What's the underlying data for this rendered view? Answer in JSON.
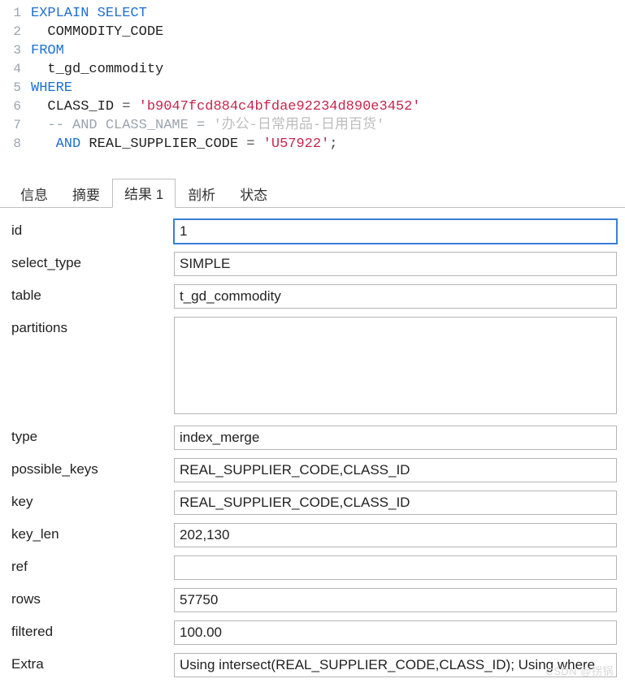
{
  "code": {
    "lines": [
      {
        "n": "1",
        "tokens": [
          {
            "t": "EXPLAIN SELECT",
            "c": "kw"
          }
        ]
      },
      {
        "n": "2",
        "tokens": [
          {
            "t": "  ",
            "c": "plain"
          },
          {
            "t": "COMMODITY_CODE",
            "c": "plain"
          }
        ]
      },
      {
        "n": "3",
        "tokens": [
          {
            "t": "FROM",
            "c": "kw"
          }
        ]
      },
      {
        "n": "4",
        "tokens": [
          {
            "t": "  ",
            "c": "plain"
          },
          {
            "t": "t_gd_commodity",
            "c": "plain"
          }
        ]
      },
      {
        "n": "5",
        "tokens": [
          {
            "t": "WHERE",
            "c": "kw"
          }
        ]
      },
      {
        "n": "6",
        "tokens": [
          {
            "t": "  ",
            "c": "plain"
          },
          {
            "t": "CLASS_ID ",
            "c": "plain"
          },
          {
            "t": "= ",
            "c": "op"
          },
          {
            "t": "'b9047fcd884c4bfdae92234d890e3452'",
            "c": "str"
          }
        ]
      },
      {
        "n": "7",
        "tokens": [
          {
            "t": "  ",
            "c": "plain"
          },
          {
            "t": "-- AND CLASS_NAME = ",
            "c": "cmt"
          },
          {
            "t": "'办公-日常用品-日用百货'",
            "c": "cmt-cn"
          }
        ]
      },
      {
        "n": "8",
        "tokens": [
          {
            "t": "   ",
            "c": "plain"
          },
          {
            "t": "AND",
            "c": "kw"
          },
          {
            "t": " REAL_SUPPLIER_CODE ",
            "c": "plain"
          },
          {
            "t": "= ",
            "c": "op"
          },
          {
            "t": "'U57922'",
            "c": "str"
          },
          {
            "t": ";",
            "c": "punc"
          }
        ]
      }
    ]
  },
  "tabs": {
    "items": [
      {
        "label": "信息"
      },
      {
        "label": "摘要"
      },
      {
        "label": "结果 1",
        "active": true
      },
      {
        "label": "剖析"
      },
      {
        "label": "状态"
      }
    ]
  },
  "result": {
    "rows": [
      {
        "label": "id",
        "value": "1",
        "focused": true
      },
      {
        "label": "select_type",
        "value": "SIMPLE"
      },
      {
        "label": "table",
        "value": "t_gd_commodity"
      },
      {
        "label": "partitions",
        "value": "",
        "tall": true
      },
      {
        "label": "type",
        "value": "index_merge"
      },
      {
        "label": "possible_keys",
        "value": "REAL_SUPPLIER_CODE,CLASS_ID"
      },
      {
        "label": "key",
        "value": "REAL_SUPPLIER_CODE,CLASS_ID"
      },
      {
        "label": "key_len",
        "value": "202,130"
      },
      {
        "label": "ref",
        "value": ""
      },
      {
        "label": "rows",
        "value": "57750"
      },
      {
        "label": "filtered",
        "value": "100.00"
      },
      {
        "label": "Extra",
        "value": "Using intersect(REAL_SUPPLIER_CODE,CLASS_ID); Using where"
      }
    ]
  },
  "watermark": "CSDN @拐锅"
}
